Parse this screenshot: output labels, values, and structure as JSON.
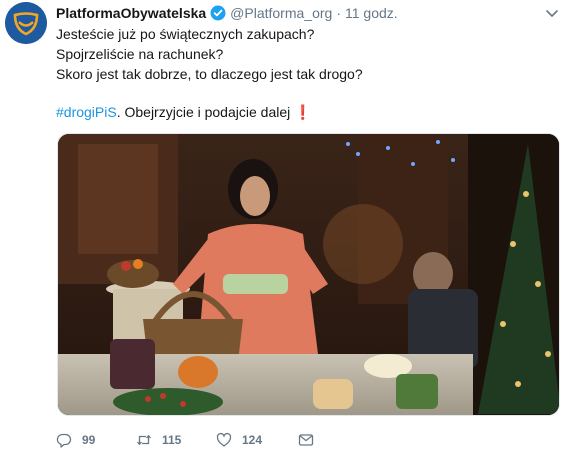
{
  "tweet": {
    "author_name": "PlatformaObywatelska",
    "handle": "@Platforma_org",
    "separator": "·",
    "time": "11 godz.",
    "lines": [
      "Jesteście już po świątecznych zakupach?",
      "Spojrzeliście na rachunek?",
      "Skoro jest tak dobrze, to dlaczego jest tak drogo?"
    ],
    "hashtag": "#drogiPiS",
    "after_hashtag": ". Obejrzyjcie i podajcie dalej",
    "exclamation": "❗"
  },
  "stats": {
    "replies": "99",
    "retweets": "115",
    "likes": "124"
  },
  "icons": {
    "avatar": "platforma-logo-icon",
    "verified": "verified-badge-icon",
    "caret": "chevron-down-icon",
    "reply": "reply-icon",
    "retweet": "retweet-icon",
    "like": "heart-icon",
    "dm": "direct-message-icon"
  },
  "colors": {
    "accent": "#1b95e0",
    "muted": "#657786",
    "brand": "#1e5aa0"
  }
}
